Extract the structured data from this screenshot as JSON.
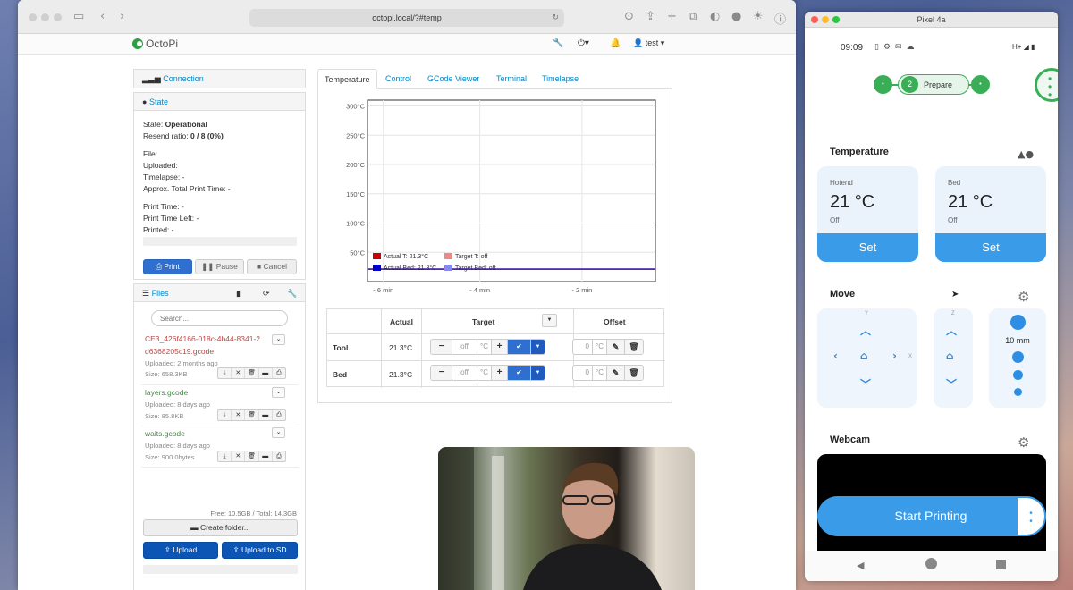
{
  "browser": {
    "url": "octopi.local/?#temp",
    "logo_text": "OctoPi",
    "user": "test"
  },
  "connection": {
    "title": "Connection"
  },
  "state": {
    "title": "State",
    "state_label": "State:",
    "state_value": "Operational",
    "resend_label": "Resend ratio:",
    "resend_value": "0 / 8 (0%)",
    "file": "File:",
    "uploaded": "Uploaded:",
    "timelapse": "Timelapse: -",
    "approx": "Approx. Total Print Time: -",
    "print_time": "Print Time: -",
    "print_time_left": "Print Time Left: -",
    "printed": "Printed: -",
    "print_btn": "Print",
    "pause_btn": "Pause",
    "cancel_btn": "Cancel"
  },
  "files": {
    "title": "Files",
    "search_placeholder": "Search...",
    "items": [
      {
        "name": "CE3_426f4166-018c-4b44-8341-2",
        "name2": "d6368205c19.gcode",
        "uploaded": "Uploaded: 2 months ago",
        "size": "Size: 658.3KB",
        "color": "#b94a48"
      },
      {
        "name": "layers.gcode",
        "uploaded": "Uploaded: 8 days ago",
        "size": "Size: 85.8KB",
        "color": "#468847"
      },
      {
        "name": "waits.gcode",
        "uploaded": "Uploaded: 8 days ago",
        "size": "Size: 900.0bytes",
        "color": "#468847"
      }
    ],
    "storage": "Free: 10.5GB / Total: 14.3GB",
    "create_folder": "Create folder...",
    "upload": "Upload",
    "upload_sd": "Upload to SD"
  },
  "tabs": [
    "Temperature",
    "Control",
    "GCode Viewer",
    "Terminal",
    "Timelapse"
  ],
  "chart_data": {
    "type": "line",
    "y_ticks": [
      "300°C",
      "250°C",
      "200°C",
      "150°C",
      "100°C",
      "50°C"
    ],
    "x_ticks": [
      "- 6 min",
      "- 4 min",
      "- 2 min"
    ],
    "ylim": [
      0,
      310
    ],
    "series": [
      {
        "name": "Actual T: 21.3°C",
        "color": "#cc0000",
        "value": 21.3
      },
      {
        "name": "Target T: off",
        "color": "#ee8888",
        "value": null
      },
      {
        "name": "Actual Bed: 21.3°C",
        "color": "#0000cc",
        "value": 21.3
      },
      {
        "name": "Target Bed: off",
        "color": "#8888ee",
        "value": null
      }
    ]
  },
  "temp_table": {
    "headers": [
      "Actual",
      "Target",
      "Offset"
    ],
    "rows": [
      {
        "name": "Tool",
        "actual": "21.3°C",
        "target": "off",
        "offset": "0"
      },
      {
        "name": "Bed",
        "actual": "21.3°C",
        "target": "off",
        "offset": "0"
      }
    ],
    "unit": "°C"
  },
  "phone": {
    "window_title": "Pixel 4a",
    "time": "09:09",
    "signal": "H+",
    "step_number": "2",
    "step_label": "Prepare",
    "temperature_title": "Temperature",
    "hotend_label": "Hotend",
    "hotend_value": "21 °C",
    "hotend_state": "Off",
    "bed_label": "Bed",
    "bed_value": "21 °C",
    "bed_state": "Off",
    "set_label": "Set",
    "move_title": "Move",
    "axis_y": "Y",
    "axis_x": "X",
    "axis_z": "Z",
    "step_size": "10 mm",
    "webcam_title": "Webcam",
    "start_printing": "Start Printing"
  }
}
